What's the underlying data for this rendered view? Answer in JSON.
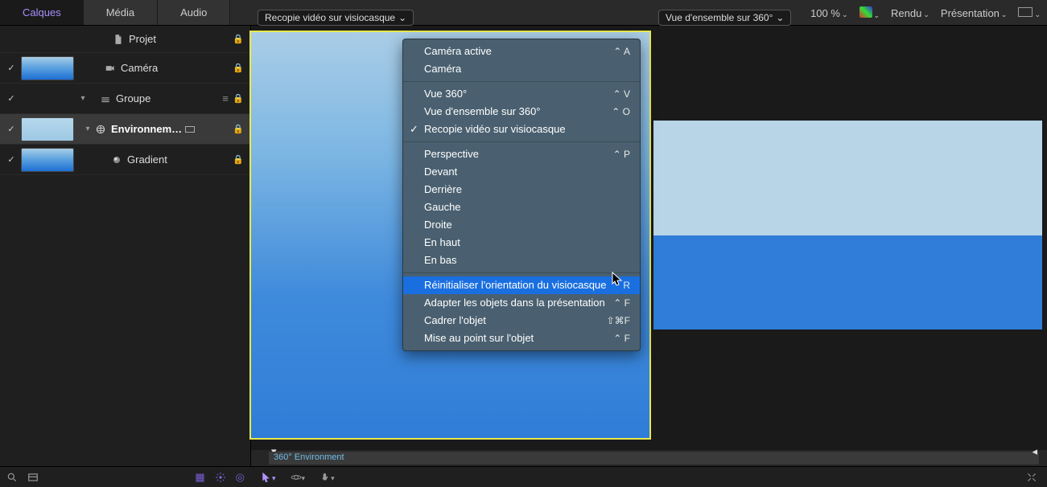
{
  "tabs": {
    "layers": "Calques",
    "media": "Média",
    "audio": "Audio"
  },
  "toolbar": {
    "zoom": "100 %",
    "render": "Rendu",
    "presentation": "Présentation"
  },
  "layers": {
    "project": "Projet",
    "camera": "Caméra",
    "group": "Groupe",
    "environment": "Environnem…",
    "gradient": "Gradient"
  },
  "viewDropdowns": {
    "left": "Recopie vidéo sur visiocasque",
    "right": "Vue d'ensemble sur 360°"
  },
  "menu": {
    "cameraActive": {
      "label": "Caméra active",
      "sc": "⌃ A"
    },
    "camera": {
      "label": "Caméra",
      "sc": ""
    },
    "view360": {
      "label": "Vue 360°",
      "sc": "⌃ V"
    },
    "overview360": {
      "label": "Vue d'ensemble sur 360°",
      "sc": "⌃ O"
    },
    "mirror": {
      "label": "Recopie vidéo sur visiocasque",
      "sc": ""
    },
    "perspective": {
      "label": "Perspective",
      "sc": "⌃ P"
    },
    "front": {
      "label": "Devant",
      "sc": ""
    },
    "back": {
      "label": "Derrière",
      "sc": ""
    },
    "left": {
      "label": "Gauche",
      "sc": ""
    },
    "right": {
      "label": "Droite",
      "sc": ""
    },
    "top": {
      "label": "En haut",
      "sc": ""
    },
    "bottom": {
      "label": "En bas",
      "sc": ""
    },
    "resetOrient": {
      "label": "Réinitialiser l'orientation du visiocasque",
      "sc": "⌃ R"
    },
    "fitObjects": {
      "label": "Adapter les objets dans la présentation",
      "sc": "⌃   F"
    },
    "frameObject": {
      "label": "Cadrer l'objet",
      "sc": "⇧⌘F"
    },
    "focusObject": {
      "label": "Mise au point sur l'objet",
      "sc": "⌃ F"
    }
  },
  "timeline": {
    "clip": "360° Environment"
  }
}
